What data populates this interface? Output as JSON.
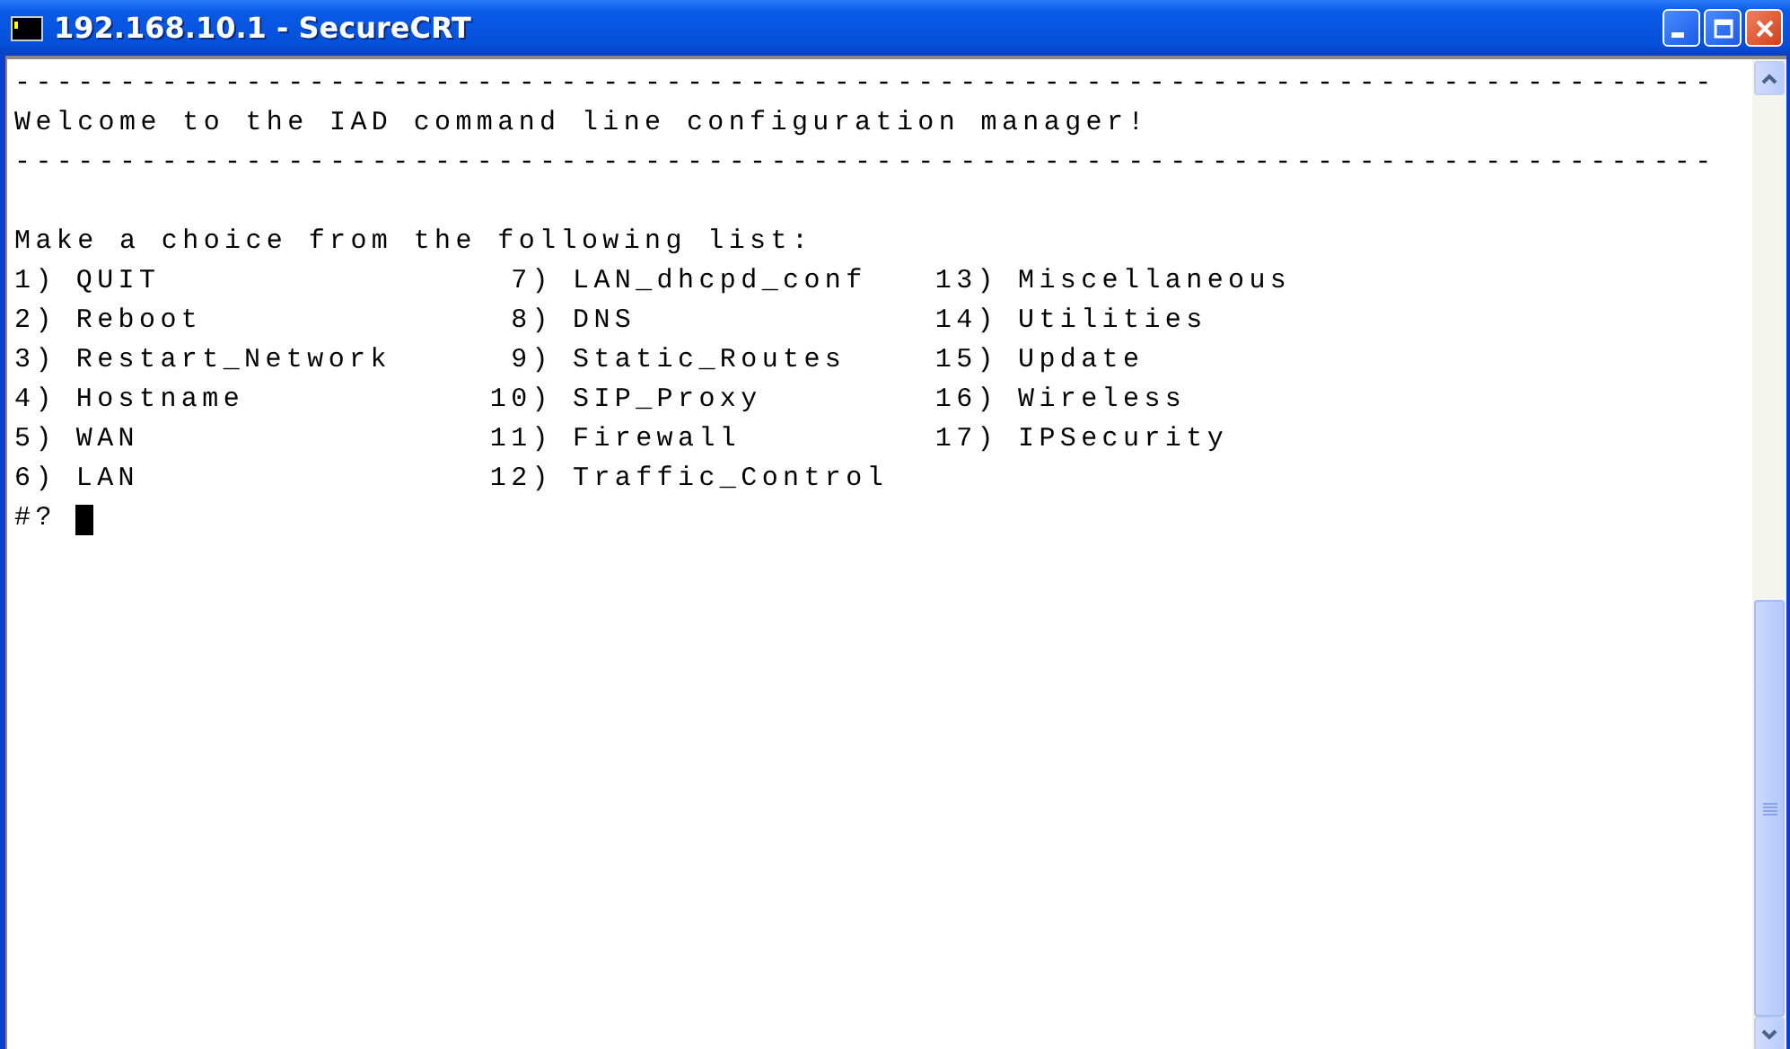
{
  "window": {
    "title": "192.168.10.1 - SecureCRT"
  },
  "terminal": {
    "rule_top": "---------------------------------------------------------------------------------",
    "welcome": "Welcome to the IAD command line configuration manager!",
    "rule_bottom": "---------------------------------------------------------------------------------",
    "heading": "Make a choice from the following list:",
    "options": [
      {
        "number": "1)",
        "label": "QUIT"
      },
      {
        "number": "2)",
        "label": "Reboot"
      },
      {
        "number": "3)",
        "label": "Restart_Network"
      },
      {
        "number": "4)",
        "label": "Hostname"
      },
      {
        "number": "5)",
        "label": "WAN"
      },
      {
        "number": "6)",
        "label": "LAN"
      },
      {
        "number": "7)",
        "label": "LAN_dhcpd_conf"
      },
      {
        "number": "8)",
        "label": "DNS"
      },
      {
        "number": "9)",
        "label": "Static_Routes"
      },
      {
        "number": "10)",
        "label": "SIP_Proxy"
      },
      {
        "number": "11)",
        "label": "Firewall"
      },
      {
        "number": "12)",
        "label": "Traffic_Control"
      },
      {
        "number": "13)",
        "label": "Miscellaneous"
      },
      {
        "number": "14)",
        "label": "Utilities"
      },
      {
        "number": "15)",
        "label": "Update"
      },
      {
        "number": "16)",
        "label": "Wireless"
      },
      {
        "number": "17)",
        "label": "IPSecurity"
      }
    ],
    "prompt": "#?"
  }
}
